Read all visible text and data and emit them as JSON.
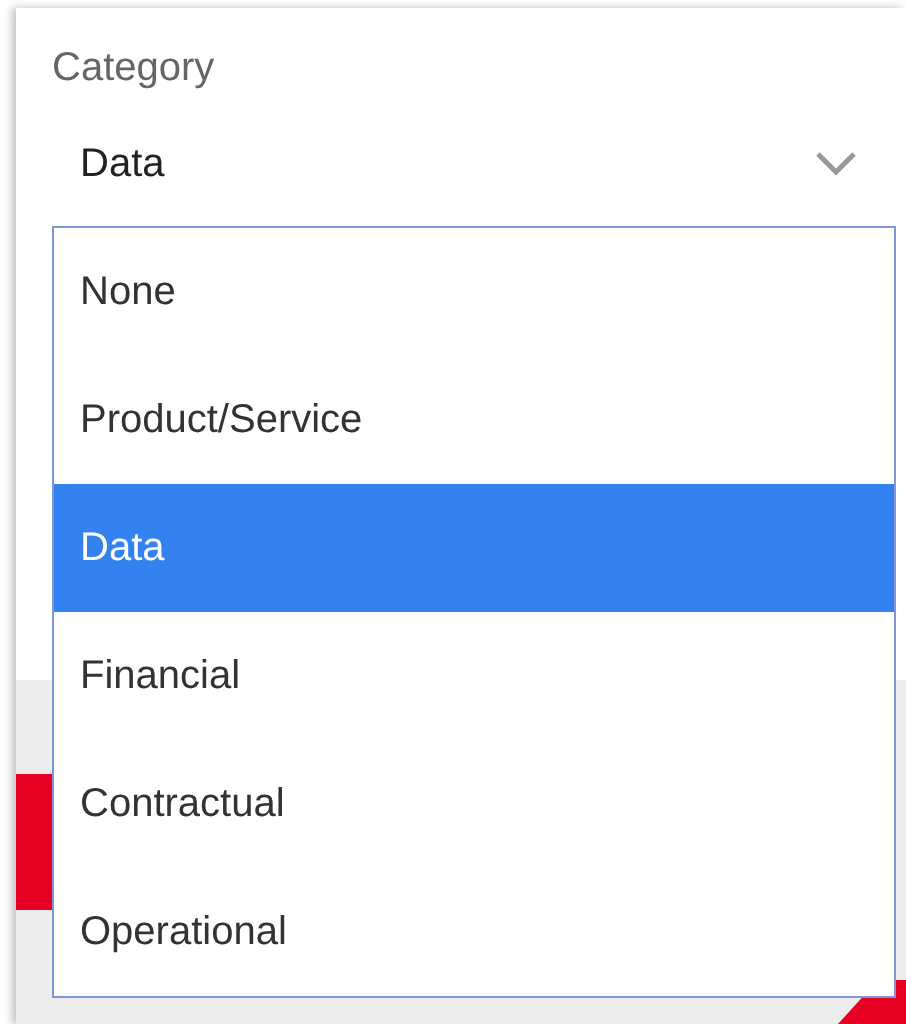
{
  "field": {
    "label": "Category",
    "value": "Data"
  },
  "options": [
    {
      "label": "None",
      "selected": false
    },
    {
      "label": "Product/Service",
      "selected": false
    },
    {
      "label": "Data",
      "selected": true
    },
    {
      "label": "Financial",
      "selected": false
    },
    {
      "label": "Contractual",
      "selected": false
    },
    {
      "label": "Operational",
      "selected": false
    }
  ]
}
